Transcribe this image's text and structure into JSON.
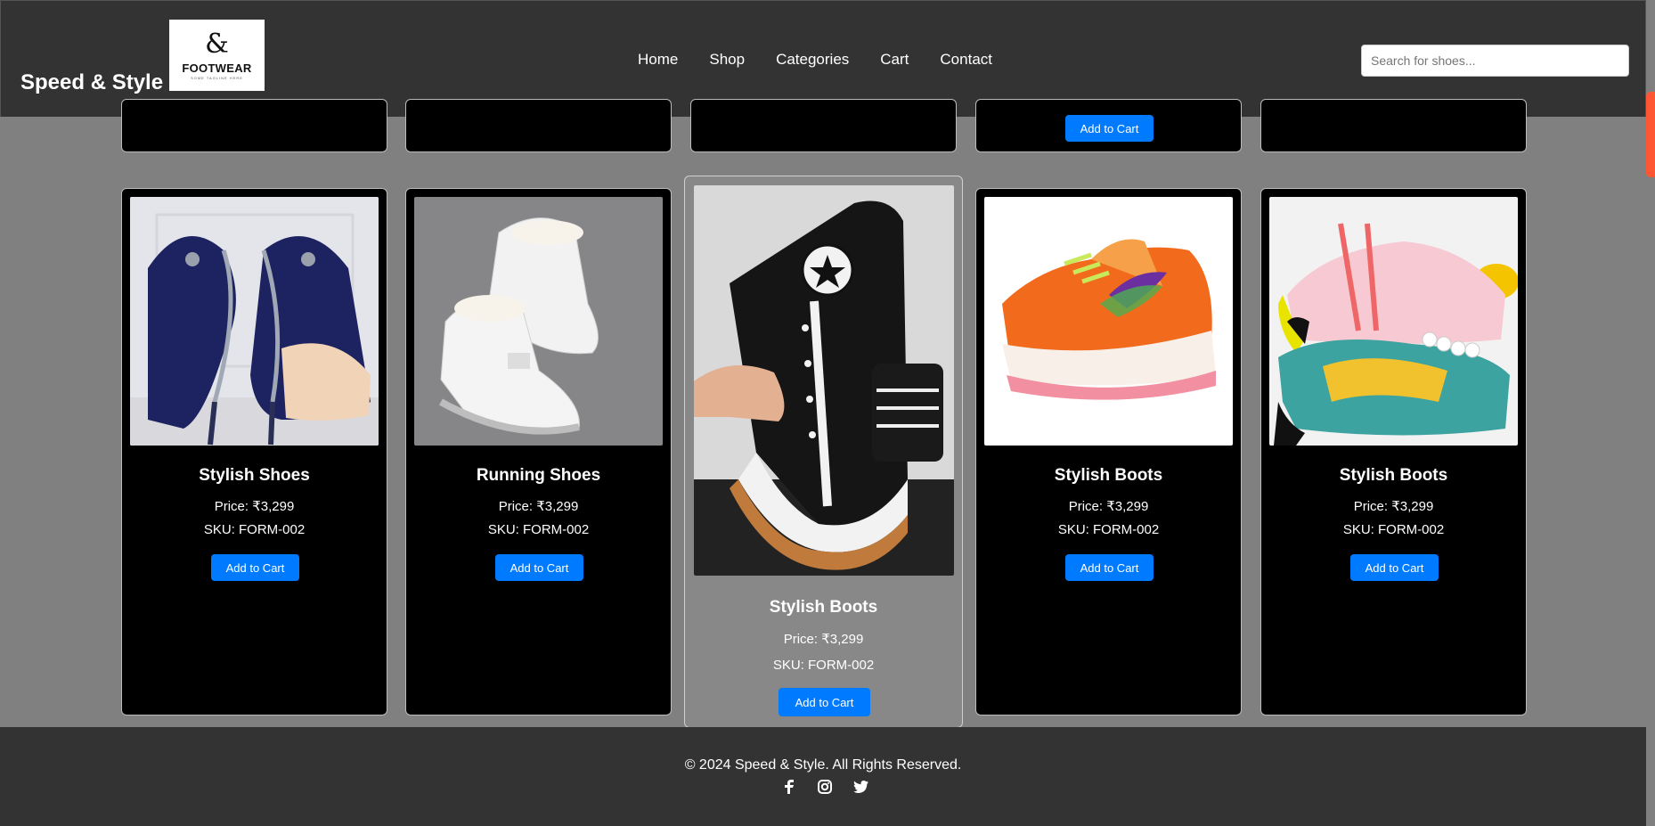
{
  "header": {
    "brand": "Speed & Style",
    "logo": {
      "symbol": "&",
      "word": "FOOTWEAR",
      "tagline": "SOME TAGLINE HERE"
    },
    "nav": [
      "Home",
      "Shop",
      "Categories",
      "Cart",
      "Contact"
    ],
    "search_placeholder": "Search for shoes..."
  },
  "top_row": {
    "button_label": "Add to Cart"
  },
  "products": [
    {
      "name": "Stylish Shoes",
      "price": "Price: ₹3,299",
      "sku": "SKU: FORM-002",
      "button": "Add to Cart",
      "image": "navy satin high heels with silver vine heel"
    },
    {
      "name": "Running Shoes",
      "price": "Price: ₹3,299",
      "sku": "SKU: FORM-002",
      "button": "Add to Cart",
      "image": "white chunky sneaker boots on grey carpet"
    },
    {
      "name": "Stylish Boots",
      "price": "Price: ₹3,299",
      "sku": "SKU: FORM-002",
      "button": "Add to Cart",
      "image": "black canvas high-top platform sneaker"
    },
    {
      "name": "Stylish Boots",
      "price": "Price: ₹3,299",
      "sku": "SKU: FORM-002",
      "button": "Add to Cart",
      "image": "orange running sneaker"
    },
    {
      "name": "Stylish Boots",
      "price": "Price: ₹3,299",
      "sku": "SKU: FORM-002",
      "button": "Add to Cart",
      "image": "colorful chunky sneakers with pearl chain"
    }
  ],
  "footer": {
    "copyright": "© 2024 Speed & Style. All Rights Reserved.",
    "socials": [
      "facebook-icon",
      "instagram-icon",
      "twitter-icon"
    ]
  },
  "colors": {
    "header_bg": "#333333",
    "page_bg": "#808080",
    "card_bg": "#000000",
    "featured_card_bg": "#888888",
    "button_bg": "#007bff",
    "scrollbar_thumb": "#ff5733"
  }
}
